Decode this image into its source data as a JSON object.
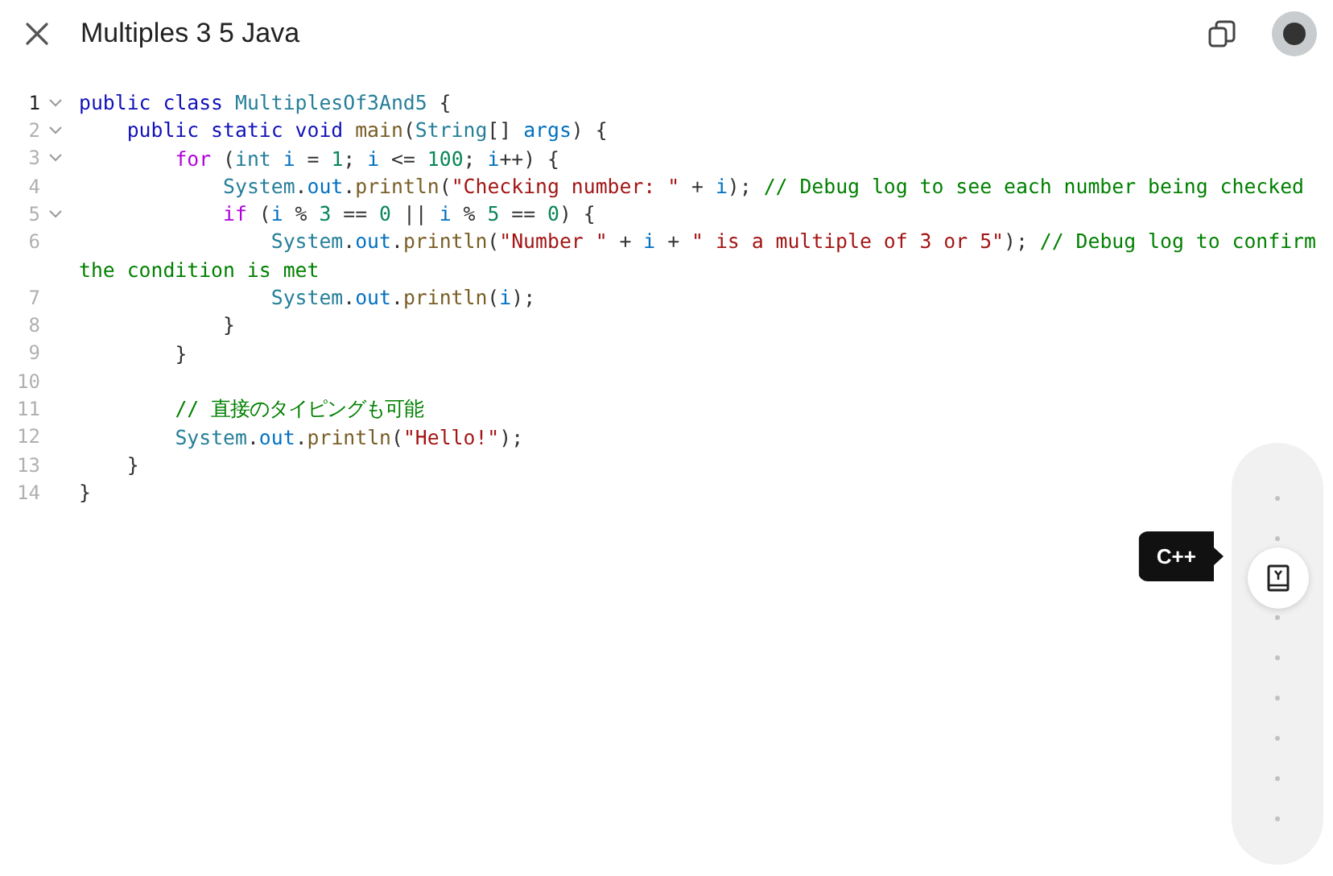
{
  "header": {
    "title": "Multiples 3 5 Java"
  },
  "editor": {
    "lines": [
      {
        "number": "1",
        "current": true,
        "fold": true,
        "tokens": [
          {
            "kind": "keyword",
            "text": "public class "
          },
          {
            "kind": "type",
            "text": "MultiplesOf3And5"
          },
          {
            "kind": "plain",
            "text": " {"
          }
        ]
      },
      {
        "number": "2",
        "current": false,
        "fold": true,
        "tokens": [
          {
            "kind": "keyword",
            "text": "    public static void "
          },
          {
            "kind": "function",
            "text": "main"
          },
          {
            "kind": "plain",
            "text": "("
          },
          {
            "kind": "type",
            "text": "String"
          },
          {
            "kind": "plain",
            "text": "[] "
          },
          {
            "kind": "variable",
            "text": "args"
          },
          {
            "kind": "plain",
            "text": ") {"
          }
        ]
      },
      {
        "number": "3",
        "current": false,
        "fold": true,
        "tokens": [
          {
            "kind": "control",
            "text": "        for"
          },
          {
            "kind": "plain",
            "text": " ("
          },
          {
            "kind": "type",
            "text": "int "
          },
          {
            "kind": "variable",
            "text": "i"
          },
          {
            "kind": "plain",
            "text": " = "
          },
          {
            "kind": "number",
            "text": "1"
          },
          {
            "kind": "plain",
            "text": "; "
          },
          {
            "kind": "variable",
            "text": "i"
          },
          {
            "kind": "plain",
            "text": " <= "
          },
          {
            "kind": "number",
            "text": "100"
          },
          {
            "kind": "plain",
            "text": "; "
          },
          {
            "kind": "variable",
            "text": "i"
          },
          {
            "kind": "plain",
            "text": "++) {"
          }
        ]
      },
      {
        "number": "4",
        "current": false,
        "fold": false,
        "tokens": [
          {
            "kind": "type",
            "text": "            System"
          },
          {
            "kind": "plain",
            "text": "."
          },
          {
            "kind": "variable",
            "text": "out"
          },
          {
            "kind": "plain",
            "text": "."
          },
          {
            "kind": "function",
            "text": "println"
          },
          {
            "kind": "plain",
            "text": "("
          },
          {
            "kind": "string",
            "text": "\"Checking number: \""
          },
          {
            "kind": "plain",
            "text": " + "
          },
          {
            "kind": "variable",
            "text": "i"
          },
          {
            "kind": "plain",
            "text": "); "
          },
          {
            "kind": "comment",
            "text": "// Debug log to see each number being checked"
          }
        ]
      },
      {
        "number": "5",
        "current": false,
        "fold": true,
        "tokens": [
          {
            "kind": "control",
            "text": "            if"
          },
          {
            "kind": "plain",
            "text": " ("
          },
          {
            "kind": "variable",
            "text": "i"
          },
          {
            "kind": "plain",
            "text": " % "
          },
          {
            "kind": "number",
            "text": "3"
          },
          {
            "kind": "plain",
            "text": " == "
          },
          {
            "kind": "number",
            "text": "0"
          },
          {
            "kind": "plain",
            "text": " || "
          },
          {
            "kind": "variable",
            "text": "i"
          },
          {
            "kind": "plain",
            "text": " % "
          },
          {
            "kind": "number",
            "text": "5"
          },
          {
            "kind": "plain",
            "text": " == "
          },
          {
            "kind": "number",
            "text": "0"
          },
          {
            "kind": "plain",
            "text": ") {"
          }
        ]
      },
      {
        "number": "6",
        "current": false,
        "fold": false,
        "tokens": [
          {
            "kind": "type",
            "text": "                System"
          },
          {
            "kind": "plain",
            "text": "."
          },
          {
            "kind": "variable",
            "text": "out"
          },
          {
            "kind": "plain",
            "text": "."
          },
          {
            "kind": "function",
            "text": "println"
          },
          {
            "kind": "plain",
            "text": "("
          },
          {
            "kind": "string",
            "text": "\"Number \""
          },
          {
            "kind": "plain",
            "text": " + "
          },
          {
            "kind": "variable",
            "text": "i"
          },
          {
            "kind": "plain",
            "text": " + "
          },
          {
            "kind": "string",
            "text": "\" is a multiple of 3 or 5\""
          },
          {
            "kind": "plain",
            "text": "); "
          },
          {
            "kind": "comment",
            "text": "// Debug log to confirm the condition is met"
          }
        ]
      },
      {
        "number": "7",
        "current": false,
        "fold": false,
        "tokens": [
          {
            "kind": "type",
            "text": "                System"
          },
          {
            "kind": "plain",
            "text": "."
          },
          {
            "kind": "variable",
            "text": "out"
          },
          {
            "kind": "plain",
            "text": "."
          },
          {
            "kind": "function",
            "text": "println"
          },
          {
            "kind": "plain",
            "text": "("
          },
          {
            "kind": "variable",
            "text": "i"
          },
          {
            "kind": "plain",
            "text": ");"
          }
        ]
      },
      {
        "number": "8",
        "current": false,
        "fold": false,
        "tokens": [
          {
            "kind": "plain",
            "text": "            }"
          }
        ]
      },
      {
        "number": "9",
        "current": false,
        "fold": false,
        "tokens": [
          {
            "kind": "plain",
            "text": "        }"
          }
        ]
      },
      {
        "number": "10",
        "current": false,
        "fold": false
      },
      {
        "number": "11",
        "current": false,
        "fold": false,
        "tokens": [
          {
            "kind": "comment",
            "text": "        // 直接のタイピングも可能"
          }
        ]
      },
      {
        "number": "12",
        "current": false,
        "fold": false,
        "tokens": [
          {
            "kind": "type",
            "text": "        System"
          },
          {
            "kind": "plain",
            "text": "."
          },
          {
            "kind": "variable",
            "text": "out"
          },
          {
            "kind": "plain",
            "text": "."
          },
          {
            "kind": "function",
            "text": "println"
          },
          {
            "kind": "plain",
            "text": "("
          },
          {
            "kind": "string",
            "text": "\"Hello!\""
          },
          {
            "kind": "plain",
            "text": ");"
          }
        ]
      },
      {
        "number": "13",
        "current": false,
        "fold": false,
        "tokens": [
          {
            "kind": "plain",
            "text": "    }"
          }
        ]
      },
      {
        "number": "14",
        "current": false,
        "fold": false,
        "tokens": [
          {
            "kind": "plain",
            "text": "}"
          }
        ]
      }
    ]
  },
  "language_picker": {
    "tooltip": "C++"
  }
}
